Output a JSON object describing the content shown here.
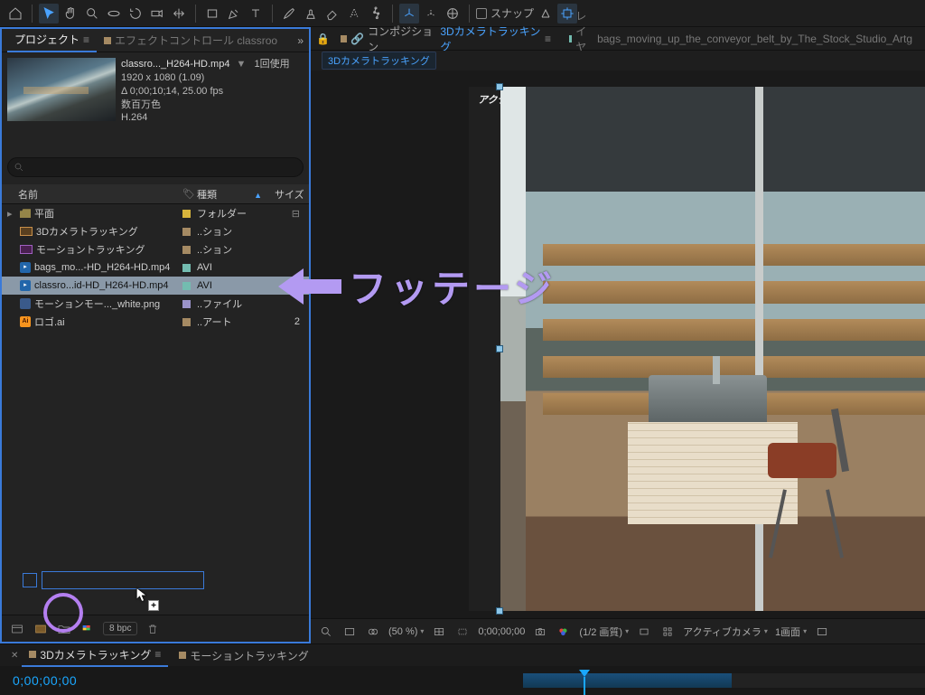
{
  "toolbar": {
    "snap_label": "スナップ"
  },
  "project_panel": {
    "tabs": {
      "project": "プロジェクト",
      "effect_controls": "エフェクトコントロール classroo"
    },
    "selected": {
      "name": "classro..._H264-HD.mp4",
      "uses": "1回使用",
      "dimensions": "1920 x 1080 (1.09)",
      "duration": "Δ 0;00;10;14, 25.00 fps",
      "colors": "数百万色",
      "codec": "H.264"
    },
    "search_placeholder": "",
    "columns": {
      "name": "名前",
      "type": "種類",
      "size": "サイズ"
    },
    "rows": [
      {
        "icon": "folder",
        "swatch": "#d7b43c",
        "name": "平面",
        "type": "フォルダー",
        "size": ""
      },
      {
        "icon": "comp",
        "swatch": "#a58a63",
        "name": "3Dカメラトラッキング",
        "type": "..ション",
        "size": ""
      },
      {
        "icon": "compM",
        "swatch": "#a58a63",
        "name": "モーショントラッキング",
        "type": "..ション",
        "size": ""
      },
      {
        "icon": "mov",
        "swatch": "#73bcb0",
        "name": "bags_mo...-HD_H264-HD.mp4",
        "type": "AVI",
        "size": ""
      },
      {
        "icon": "mov",
        "swatch": "#73bcb0",
        "name": "classro...id-HD_H264-HD.mp4",
        "type": "AVI",
        "size": "",
        "selected": true
      },
      {
        "icon": "img",
        "swatch": "#9a93c9",
        "name": "モーションモー..._white.png",
        "type": "..ファイル",
        "size": ""
      },
      {
        "icon": "ai",
        "swatch": "#a58a63",
        "name": "ロゴ.ai",
        "type": "..アート",
        "size": "2"
      }
    ],
    "bottom": {
      "bpc": "8 bpc"
    }
  },
  "viewer": {
    "tabs": {
      "comp_prefix": "コンポジション",
      "comp_name": "3Dカメラトラッキング",
      "layer_prefix": "レイヤー",
      "layer_name": "bags_moving_up_the_conveyor_belt_by_The_Stock_Studio_Artg"
    },
    "breadcrumb": "3Dカメラトラッキング",
    "camera_label": "アクティブカメラ",
    "bottom": {
      "zoom": "(50 %)",
      "time": "0;00;00;00",
      "quality": "(1/2 画質)",
      "camera": "アクティブカメラ",
      "viewcount": "1画面"
    }
  },
  "timeline": {
    "tabs": {
      "active": "3Dカメラトラッキング",
      "other": "モーショントラッキング"
    },
    "time": "0;00;00;00"
  },
  "annotation": {
    "label": "フッテージ"
  }
}
